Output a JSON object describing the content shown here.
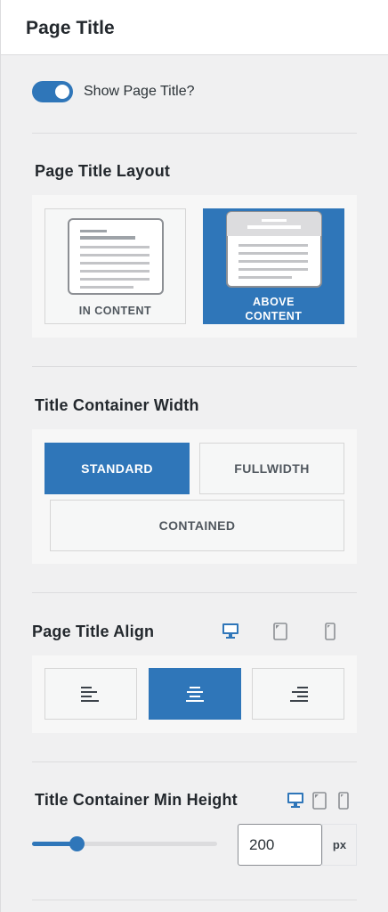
{
  "header": {
    "title": "Page Title"
  },
  "show_title": {
    "label": "Show Page Title?",
    "enabled": true
  },
  "layout": {
    "title": "Page Title Layout",
    "options": [
      {
        "label": "IN CONTENT",
        "selected": false
      },
      {
        "label": "ABOVE CONTENT",
        "selected": true
      }
    ]
  },
  "container_width": {
    "title": "Title Container Width",
    "options": [
      {
        "label": "STANDARD",
        "selected": true
      },
      {
        "label": "FULLWIDTH",
        "selected": false
      },
      {
        "label": "CONTAINED",
        "selected": false
      }
    ]
  },
  "align": {
    "title": "Page Title Align",
    "devices": [
      {
        "icon": "desktop-icon",
        "active": true
      },
      {
        "icon": "tablet-icon",
        "active": false
      },
      {
        "icon": "mobile-icon",
        "active": false
      }
    ],
    "options": [
      {
        "icon": "align-left-icon",
        "selected": false
      },
      {
        "icon": "align-center-icon",
        "selected": true
      },
      {
        "icon": "align-right-icon",
        "selected": false
      }
    ]
  },
  "min_height": {
    "title": "Title Container Min Height",
    "devices": [
      {
        "icon": "desktop-icon",
        "active": true
      },
      {
        "icon": "tablet-icon",
        "active": false
      },
      {
        "icon": "mobile-icon",
        "active": false
      }
    ],
    "value": "200",
    "unit": "px",
    "slider_fraction": 0.24
  },
  "colors": {
    "accent": "#2f76b9",
    "panel_bg": "#f0f0f1",
    "box_bg": "#f7f7f7"
  }
}
